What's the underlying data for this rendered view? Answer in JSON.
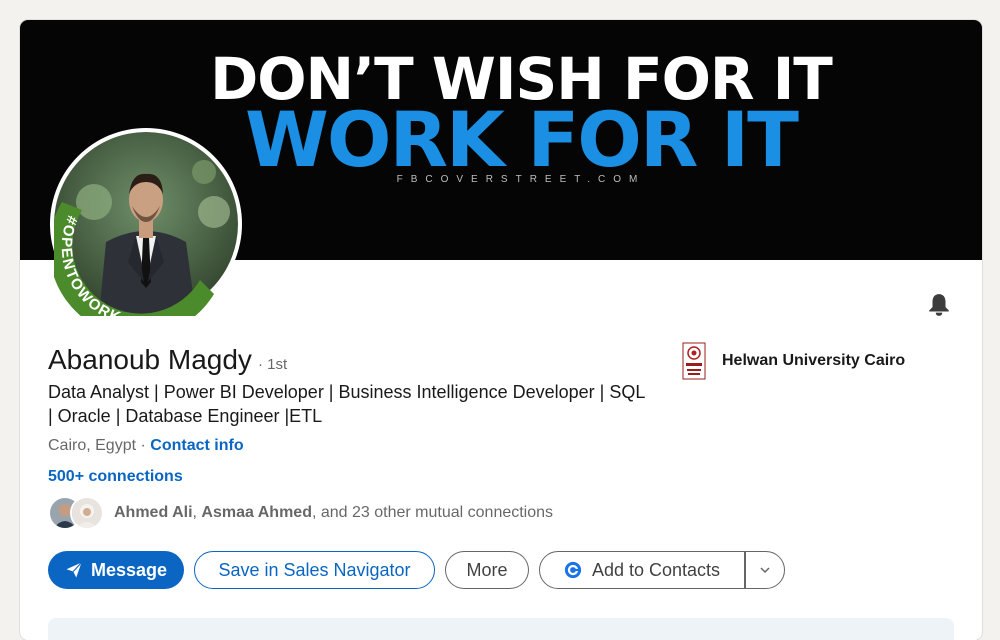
{
  "banner": {
    "line1": "DON’T WISH FOR IT",
    "line2": "WORK FOR IT",
    "credit": "FBCOVERSTREET.COM"
  },
  "avatar": {
    "frame_text": "#OPENTOWORK",
    "frame_color": "#4c8b2b"
  },
  "profile": {
    "name": "Abanoub Magdy",
    "degree": "· 1st",
    "headline": "Data Analyst | Power BI Developer | Business Intelligence Developer | SQL | Oracle | Database Engineer |ETL",
    "location": "Cairo, Egypt",
    "location_sep": " · ",
    "contact_info": "Contact info",
    "connections": "500+ connections"
  },
  "mutual": {
    "name1": "Ahmed Ali",
    "sep": ", ",
    "name2": "Asmaa Ahmed",
    "rest": ", and 23 other mutual connections"
  },
  "school": {
    "name": "Helwan University Cairo",
    "logo_text": "HELWAN UNIVERSITY"
  },
  "actions": {
    "message": "Message",
    "save_sales_nav": "Save in Sales Navigator",
    "more": "More",
    "add_to_contacts": "Add to Contacts"
  },
  "icons": {
    "bell": "bell-icon",
    "send": "send-icon",
    "contacts": "google-contacts-icon",
    "caret": "chevron-down-icon"
  },
  "colors": {
    "brand_blue": "#0a66c2",
    "banner_blue": "#1a8fe3",
    "opentowork_green": "#4c8b2b"
  }
}
